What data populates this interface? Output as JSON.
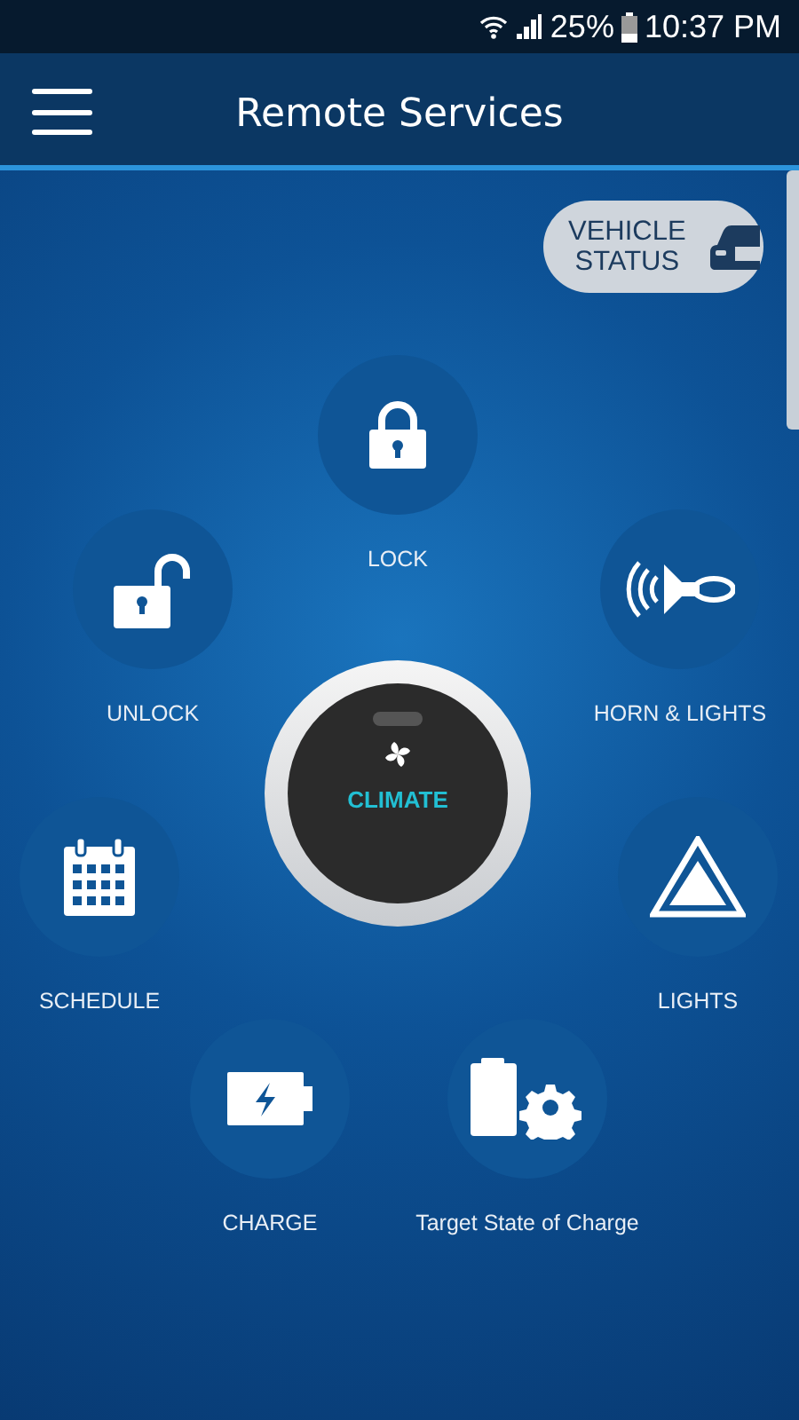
{
  "status_bar": {
    "battery": "25%",
    "time": "10:37 PM"
  },
  "header": {
    "title": "Remote Services"
  },
  "vehicle_status": {
    "label_line_1": "VEHICLE",
    "label_line_2": "STATUS"
  },
  "climate": {
    "label": "CLIMATE"
  },
  "services": [
    {
      "kind": "lock",
      "label": "LOCK"
    },
    {
      "kind": "unlock",
      "label": "UNLOCK"
    },
    {
      "kind": "horn",
      "label": "HORN & LIGHTS"
    },
    {
      "kind": "schedule",
      "label": "SCHEDULE"
    },
    {
      "kind": "lights",
      "label": "LIGHTS"
    },
    {
      "kind": "charge",
      "label": "CHARGE"
    },
    {
      "kind": "target",
      "label": "Target State of Charge"
    }
  ]
}
